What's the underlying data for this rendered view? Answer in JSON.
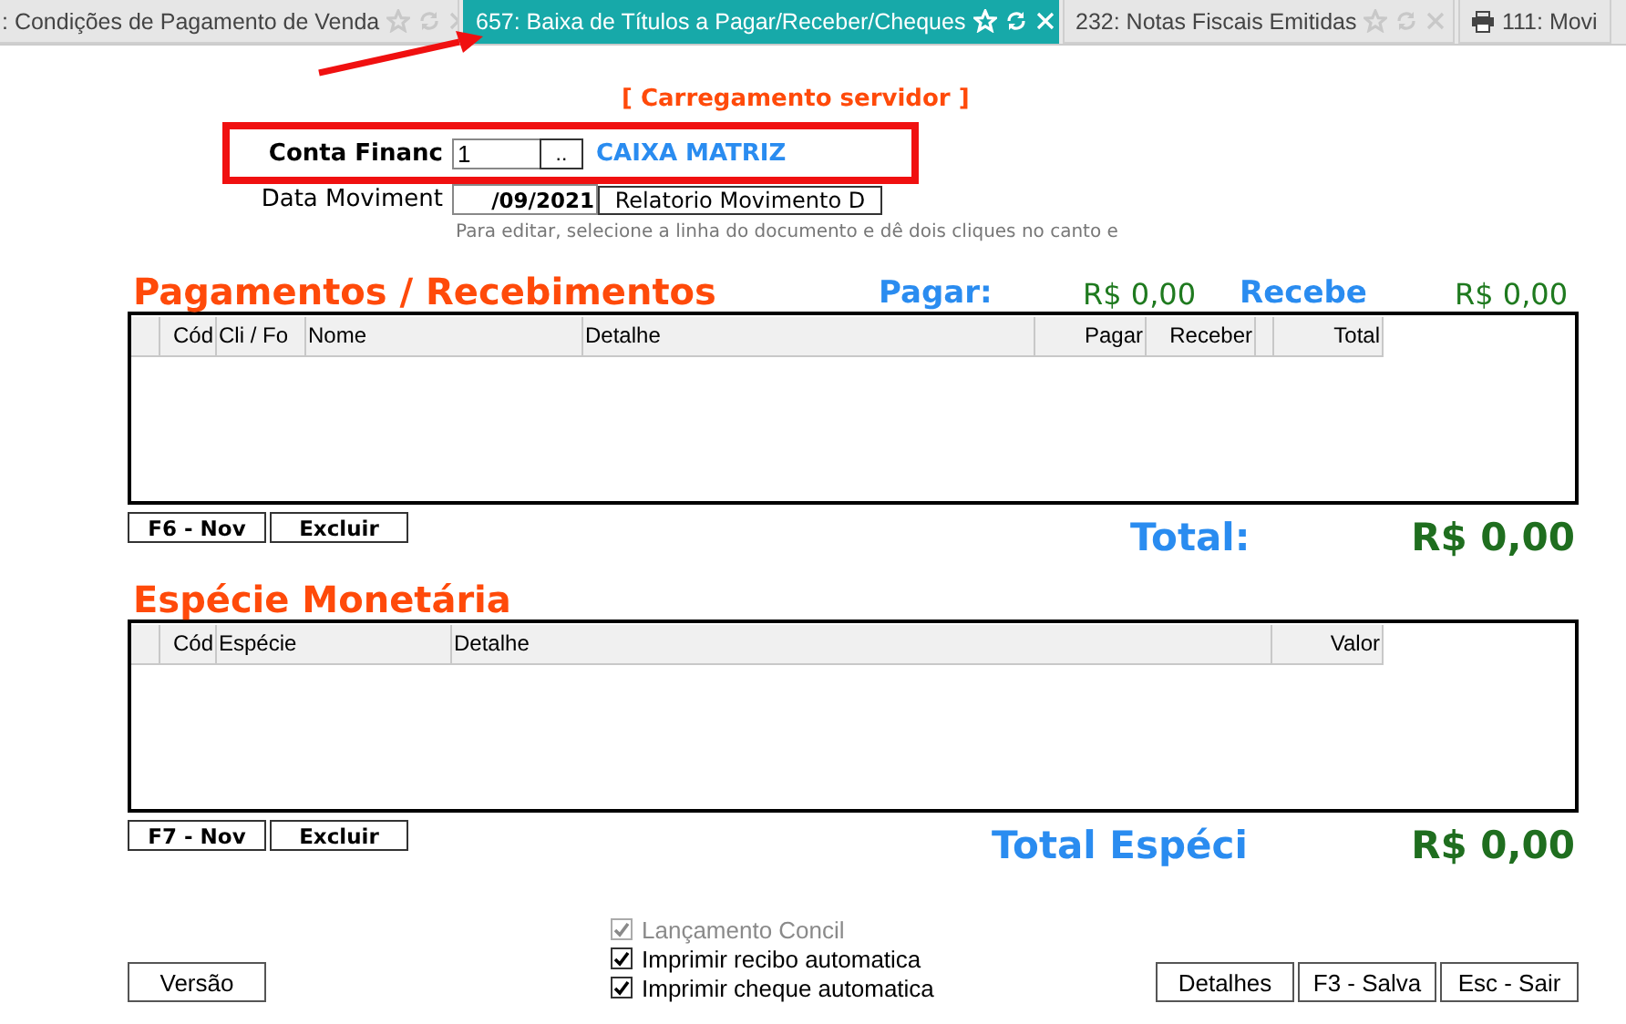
{
  "tabs": [
    {
      "label": ": Condições de Pagamento de Venda",
      "selected": false,
      "kind": "closable"
    },
    {
      "label": "657: Baixa de Títulos a Pagar/Receber/Cheques",
      "selected": true,
      "kind": "closable"
    },
    {
      "label": "232: Notas Fiscais Emitidas",
      "selected": false,
      "kind": "closable"
    },
    {
      "label": "111: Movi",
      "selected": false,
      "kind": "print"
    }
  ],
  "status": "[ Carregamento servidor ]",
  "account": {
    "label": "Conta Financ",
    "value": "1",
    "button": "..",
    "name": "CAIXA MATRIZ"
  },
  "date": {
    "label": "Data Moviment",
    "value": "/09/2021",
    "report_button": "Relatorio Movimento D"
  },
  "hint": "Para editar, selecione a linha do documento e dê dois cliques no canto e",
  "sections": [
    {
      "title": "Pagamentos / Recebimentos",
      "summary": [
        {
          "label": "Pagar:",
          "value": "R$ 0,00"
        },
        {
          "label": "Recebe",
          "value": "R$ 0,00"
        }
      ],
      "columns": [
        "Cód",
        "Cli / Fo",
        "Nome",
        "Detalhe",
        "Pagar",
        "Receber",
        "Total"
      ],
      "buttons": [
        "F6 - Nov",
        "Excluir"
      ],
      "total_label": "Total:",
      "total_value": "R$ 0,00"
    },
    {
      "title": "Espécie Monetária",
      "columns": [
        "Cód",
        "Espécie",
        "Detalhe",
        "Valor"
      ],
      "buttons": [
        "F7 - Nov",
        "Excluir"
      ],
      "total_label": "Total Espéci",
      "total_value": "R$ 0,00"
    }
  ],
  "options": [
    {
      "label": "Lançamento Concil",
      "checked": true,
      "disabled": true
    },
    {
      "label": "Imprimir recibo automatica",
      "checked": true,
      "disabled": false
    },
    {
      "label": "Imprimir cheque automatica",
      "checked": true,
      "disabled": false
    }
  ],
  "left_buttons": [
    "Versão"
  ],
  "right_buttons": [
    "Detalhes",
    "F3 - Salva",
    "Esc - Sair"
  ]
}
